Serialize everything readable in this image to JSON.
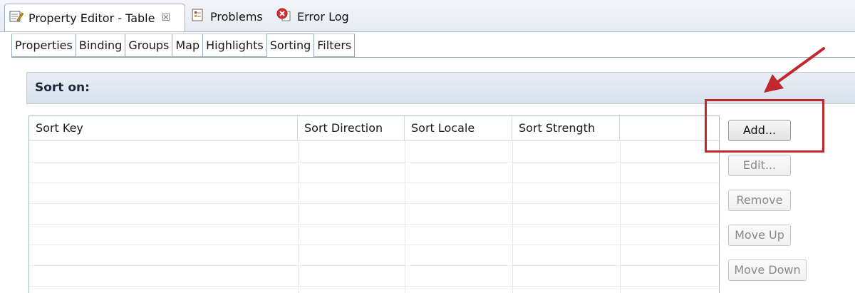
{
  "view_tabs": [
    {
      "label": "Property Editor - Table",
      "icon": "property-editor-icon",
      "active": true,
      "close_glyph": "☒"
    },
    {
      "label": "Problems",
      "icon": "problems-icon",
      "active": false
    },
    {
      "label": "Error Log",
      "icon": "error-log-icon",
      "active": false
    }
  ],
  "property_tabs": [
    "Properties",
    "Binding",
    "Groups",
    "Map",
    "Highlights",
    "Sorting",
    "Filters"
  ],
  "active_property_tab": "Sorting",
  "section": {
    "title": "Sort on:"
  },
  "table": {
    "columns": [
      "Sort Key",
      "Sort Direction",
      "Sort Locale",
      "Sort Strength",
      ""
    ],
    "rows": []
  },
  "buttons": {
    "add": "Add...",
    "edit": "Edit...",
    "remove": "Remove",
    "move_up": "Move Up",
    "move_down": "Move Down"
  },
  "annotation": {
    "color": "#c0282d"
  }
}
